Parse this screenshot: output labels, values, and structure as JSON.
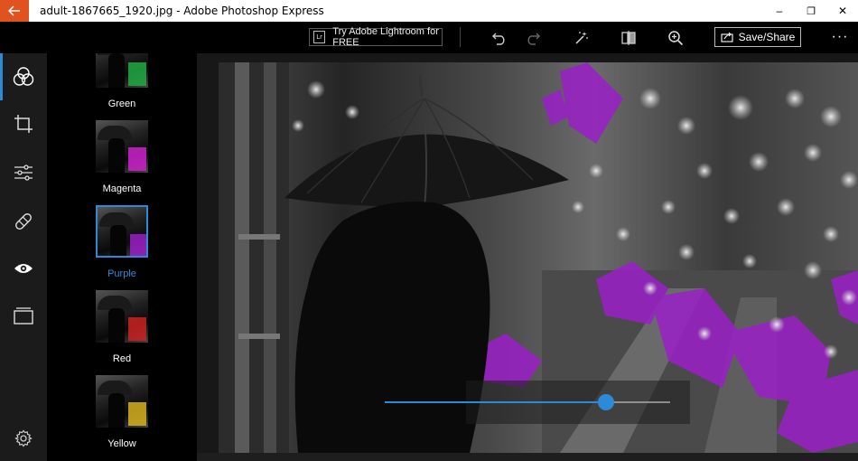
{
  "window": {
    "title": "adult-1867665_1920.jpg - Adobe Photoshop Express",
    "minimize": "–",
    "maximize": "❐",
    "close": "✕"
  },
  "toolbar": {
    "lightroom_badge": "Lr",
    "lightroom_label": "Try Adobe Lightroom for FREE",
    "save_label": "Save/Share",
    "more_label": "···"
  },
  "rail": {
    "items": [
      {
        "name": "looks-icon",
        "active": true
      },
      {
        "name": "crop-icon"
      },
      {
        "name": "adjust-sliders-icon"
      },
      {
        "name": "healing-bandage-icon"
      },
      {
        "name": "eye-icon"
      },
      {
        "name": "borders-icon"
      }
    ],
    "settings": "gear-icon"
  },
  "filters": [
    {
      "label": "Green",
      "accent": "#22aa44"
    },
    {
      "label": "Magenta",
      "accent": "#cc22cc"
    },
    {
      "label": "Purple",
      "accent": "#9a1fc8",
      "selected": true
    },
    {
      "label": "Red",
      "accent": "#cc2222"
    },
    {
      "label": "Yellow",
      "accent": "#d6b020"
    }
  ],
  "slider": {
    "value": 0.75,
    "accent": "#2d8ad6"
  },
  "colors": {
    "accent": "#2d8ad6",
    "back_button": "#e0531f",
    "highlight": "#9a1fc8"
  }
}
